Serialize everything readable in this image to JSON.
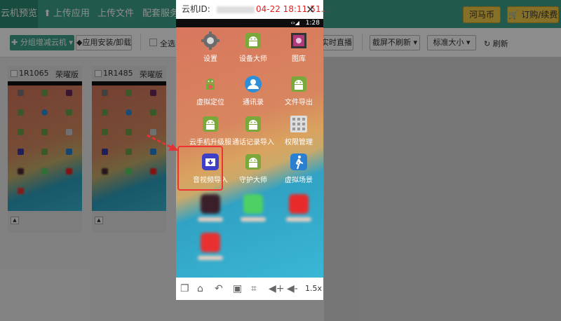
{
  "topnav": {
    "tabs": [
      {
        "label": "云机预览",
        "icon": ""
      },
      {
        "label": "上传应用",
        "icon": "upload-icon"
      },
      {
        "label": "上传文件",
        "icon": ""
      },
      {
        "label": "配套服务",
        "icon": ""
      }
    ],
    "coin_button": "河马币",
    "order_button": "订购/续费"
  },
  "toolbar": {
    "group_button": "分组增减云机",
    "install_button": "应用安装/卸载",
    "select_all": "全选",
    "live_button": "实时直播",
    "screenshot_dropdown": "截屏不刷新",
    "size_dropdown": "标准大小",
    "refresh": "刷新"
  },
  "cards": [
    {
      "name": "1R1065",
      "brand": "荣曜版"
    },
    {
      "name": "1R1485",
      "brand": "荣曜版"
    }
  ],
  "modal": {
    "title_prefix": "云机ID:",
    "timestamp": "04-22 18:11:51...",
    "status_time": "1:28",
    "zoom": "1.5x",
    "apps": [
      {
        "label": "设置",
        "icon": "settings-gear-icon"
      },
      {
        "label": "设备大师",
        "icon": "android-icon"
      },
      {
        "label": "图库",
        "icon": "gallery-icon"
      },
      {
        "label": "虚拟定位",
        "icon": "android-location-icon"
      },
      {
        "label": "通讯录",
        "icon": "contacts-icon"
      },
      {
        "label": "文件导出",
        "icon": "android-icon"
      },
      {
        "label": "云手机升级服",
        "icon": "android-icon"
      },
      {
        "label": "通话记录导入",
        "icon": "android-icon"
      },
      {
        "label": "权限管理",
        "icon": "grid-icon"
      },
      {
        "label": "音视频导入",
        "icon": "media-import-icon"
      },
      {
        "label": "守护大师",
        "icon": "android-icon"
      },
      {
        "label": "虚拟场景",
        "icon": "walker-icon"
      }
    ]
  },
  "colors": {
    "brand_green": "#3da58b",
    "highlight_red": "#e33333",
    "timestamp_red": "#e02020",
    "gold_button": "#f4cc48"
  }
}
